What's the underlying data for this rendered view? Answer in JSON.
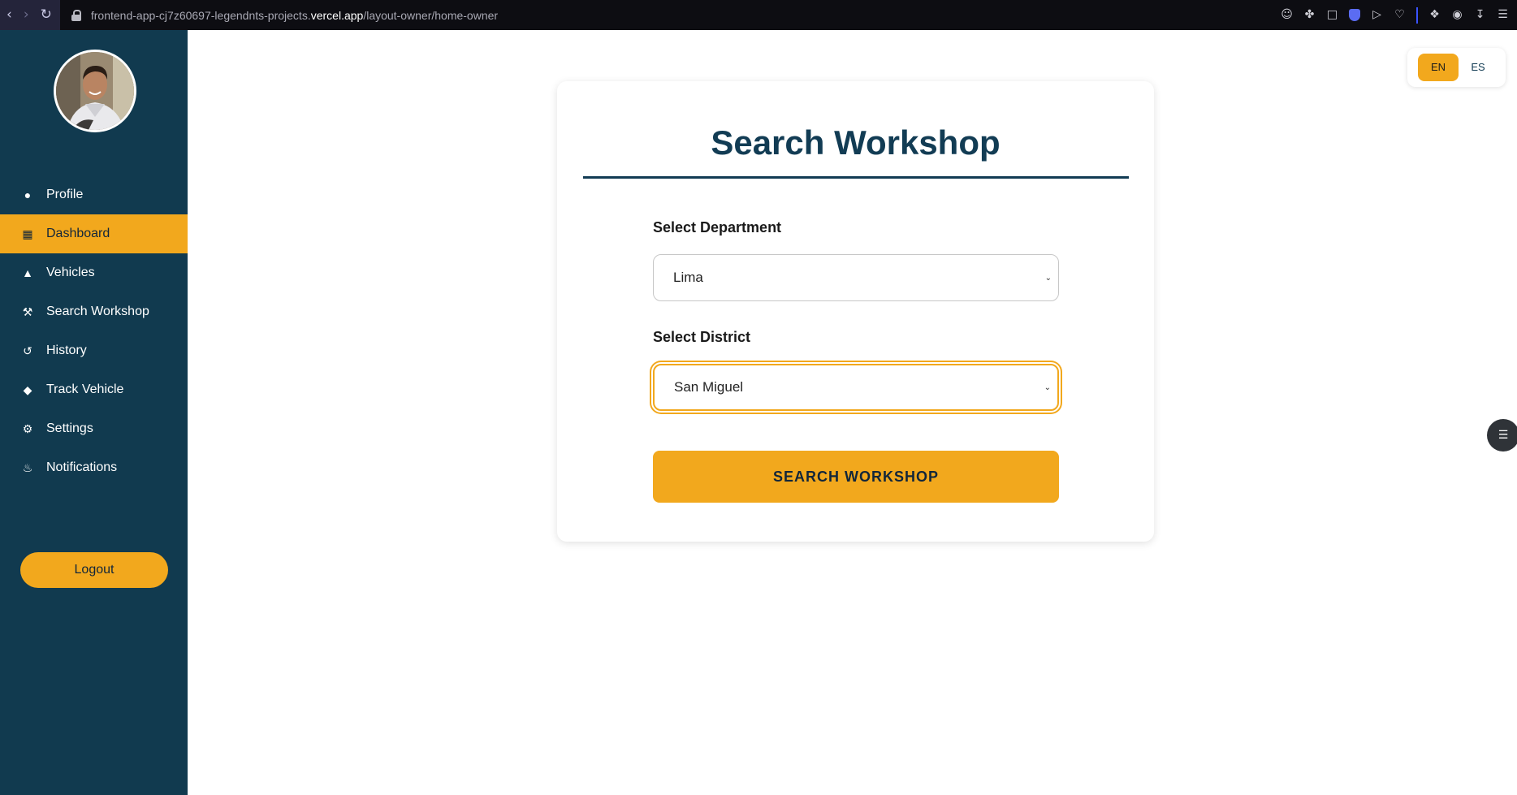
{
  "browser": {
    "url_prefix": "frontend-app-cj7z60697-legendnts-projects.",
    "url_domain": "vercel.app",
    "url_path": "/layout-owner/home-owner"
  },
  "sidebar": {
    "items": [
      {
        "label": "Profile",
        "icon": "person-icon"
      },
      {
        "label": "Dashboard",
        "icon": "grid-icon",
        "active": true
      },
      {
        "label": "Vehicles",
        "icon": "car-icon"
      },
      {
        "label": "Search Workshop",
        "icon": "wrench-icon"
      },
      {
        "label": "History",
        "icon": "history-icon"
      },
      {
        "label": "Track Vehicle",
        "icon": "diamond-icon"
      },
      {
        "label": "Settings",
        "icon": "gear-icon"
      },
      {
        "label": "Notifications",
        "icon": "bell-icon"
      }
    ],
    "logout_label": "Logout"
  },
  "main": {
    "title": "Search Workshop",
    "department": {
      "label": "Select Department",
      "value": "Lima"
    },
    "district": {
      "label": "Select District",
      "value": "San Miguel"
    },
    "search_button": "SEARCH WORKSHOP"
  },
  "language": {
    "options": [
      "EN",
      "ES"
    ],
    "selected": "EN"
  },
  "colors": {
    "sidebar_bg": "#113a4f",
    "accent": "#f2a81d",
    "title": "#123c54"
  }
}
